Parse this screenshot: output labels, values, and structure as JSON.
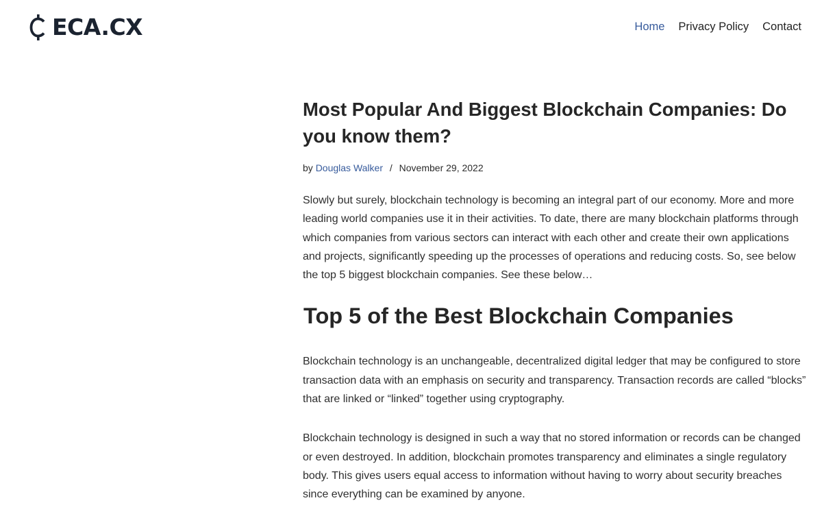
{
  "site": {
    "logo_text": "ECA.CX",
    "logo_icon": "cent-icon",
    "brand_color": "#1b2330",
    "link_color": "#375b9c"
  },
  "nav": {
    "items": [
      {
        "label": "Home",
        "active": true
      },
      {
        "label": "Privacy Policy",
        "active": false
      },
      {
        "label": "Contact",
        "active": false
      }
    ]
  },
  "article": {
    "title": "Most Popular And Biggest Blockchain Companies: Do you know them?",
    "meta": {
      "by": "by",
      "author": "Douglas Walker",
      "separator": "/",
      "date": "November 29, 2022"
    },
    "intro": "Slowly but surely, blockchain technology is becoming an integral part of our economy. More and more leading world companies use it in their activities. To date, there are many blockchain platforms through which companies from various sectors can interact with each other and create their own applications and projects, significantly speeding up the processes of operations and reducing costs. So, see below the top 5 biggest blockchain companies. See these below…",
    "section_heading": "Top 5 of the Best Blockchain Companies",
    "paragraphs": [
      "Blockchain technology is an unchangeable, decentralized digital ledger that may be configured to store transaction data with an emphasis on security and transparency. Transaction records are called “blocks” that are linked or “linked” together using cryptography.",
      "Blockchain technology is designed in such a way that no stored information or records can be changed or even destroyed. In addition, blockchain promotes transparency and eliminates a single regulatory body. This gives users equal access to information without having to worry about security breaches since everything can be examined by anyone."
    ]
  }
}
